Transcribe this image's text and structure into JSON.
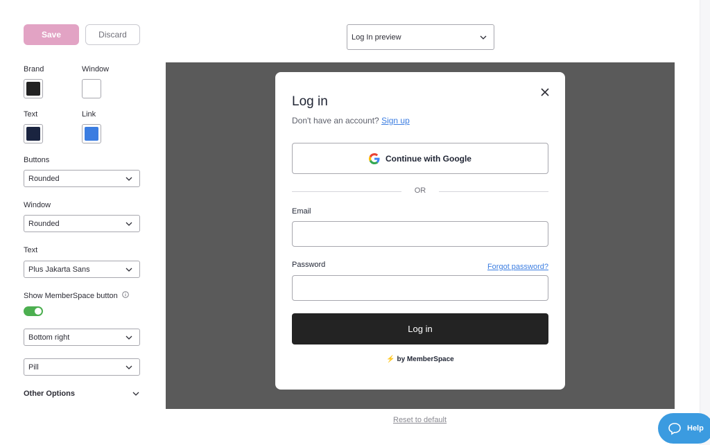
{
  "toolbar": {
    "save_label": "Save",
    "discard_label": "Discard"
  },
  "colors": {
    "brand_label": "Brand",
    "brand_value": "#222222",
    "window_label": "Window",
    "window_value": "#ffffff",
    "text_label": "Text",
    "text_value": "#1a2440",
    "link_label": "Link",
    "link_value": "#3b7de1"
  },
  "settings": {
    "buttons_label": "Buttons",
    "buttons_value": "Rounded",
    "window_label": "Window",
    "window_value": "Rounded",
    "text_label": "Text",
    "text_value": "Plus Jakarta Sans",
    "show_button_label": "Show MemberSpace button",
    "show_button_enabled": true,
    "position_value": "Bottom right",
    "shape_value": "Pill",
    "other_options_label": "Other Options"
  },
  "preview": {
    "selected": "Log In preview",
    "reset_label": "Reset to default"
  },
  "modal": {
    "title": "Log in",
    "subtitle": "Don't have an account?",
    "signup_link": "Sign up",
    "google_button": "Continue with Google",
    "or_label": "OR",
    "email_label": "Email",
    "password_label": "Password",
    "forgot_link": "Forgot password?",
    "login_button": "Log in",
    "byline": "by MemberSpace"
  },
  "help": {
    "label": "Help"
  }
}
